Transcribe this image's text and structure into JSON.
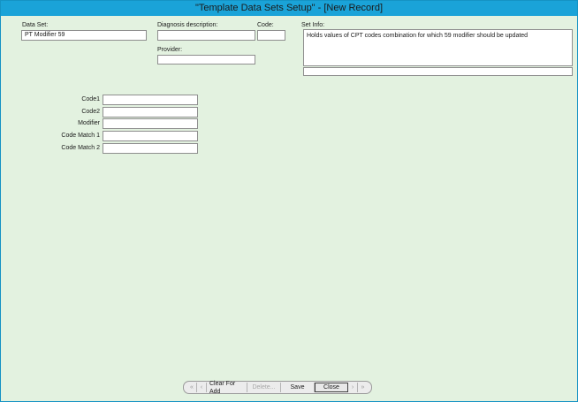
{
  "window": {
    "title": "\"Template Data Sets Setup\" - [New Record]"
  },
  "header_fields": {
    "data_set_label": "Data Set:",
    "data_set_value": "PT Modifier 59",
    "diagnosis_label": "Diagnosis description:",
    "diagnosis_value": "",
    "code_label": "Code:",
    "code_value": "",
    "provider_label": "Provider:",
    "provider_value": "",
    "set_info_label": "Set Info:",
    "set_info_value": "Holds values of CPT codes combination for which 59 modifier should be updated",
    "set_info_extra_value": ""
  },
  "fields": [
    {
      "label": "Code1",
      "value": ""
    },
    {
      "label": "Code2",
      "value": ""
    },
    {
      "label": "Modifier",
      "value": ""
    },
    {
      "label": "Code Match 1",
      "value": ""
    },
    {
      "label": "Code Match 2",
      "value": ""
    }
  ],
  "nav": {
    "first_icon": "first-record-icon",
    "prev_icon": "previous-record-icon",
    "next_icon": "next-record-icon",
    "last_icon": "last-record-icon",
    "first_glyph": "«",
    "prev_glyph": "‹",
    "next_glyph": "›",
    "last_glyph": "»",
    "clear_label": "Clear For Add",
    "delete_label": "Delete...",
    "save_label": "Save",
    "close_label": "Close"
  },
  "colors": {
    "title_bar": "#1aa3d8",
    "form_background": "#e3f2e0"
  }
}
